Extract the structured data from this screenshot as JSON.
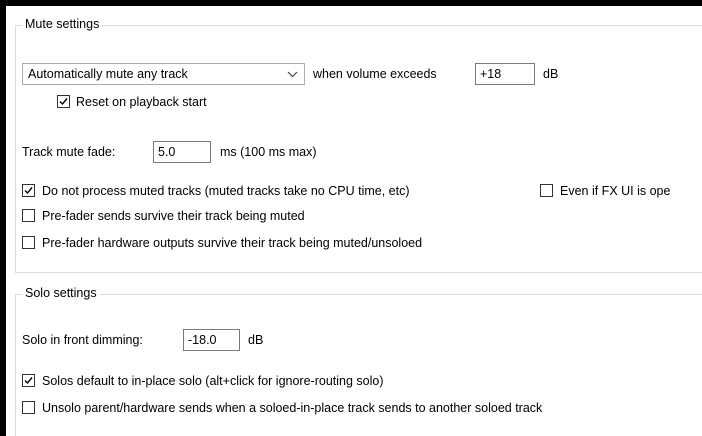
{
  "mute": {
    "title": "Mute settings",
    "auto_mute_select": "Automatically mute any track",
    "when_label": "when volume exceeds",
    "threshold_value": "+18",
    "threshold_unit": "dB",
    "reset_label": "Reset on playback start",
    "reset_checked": true,
    "fade_label": "Track mute fade:",
    "fade_value": "5.0",
    "fade_unit": "ms (100 ms max)",
    "no_process_label": "Do not process muted tracks (muted tracks take no CPU time, etc)",
    "no_process_checked": true,
    "even_fx_label": "Even if FX UI is ope",
    "even_fx_checked": false,
    "prefader_sends_label": "Pre-fader sends survive their track being muted",
    "prefader_sends_checked": false,
    "prefader_hw_label": "Pre-fader hardware outputs survive their track being muted/unsoloed",
    "prefader_hw_checked": false
  },
  "solo": {
    "title": "Solo settings",
    "dimming_label": "Solo in front dimming:",
    "dimming_value": "-18.0",
    "dimming_unit": "dB",
    "inplace_label": "Solos default to in-place solo (alt+click for ignore-routing solo)",
    "inplace_checked": true,
    "unsolo_label": "Unsolo parent/hardware sends when a soloed-in-place track sends to another soloed track",
    "unsolo_checked": false
  }
}
